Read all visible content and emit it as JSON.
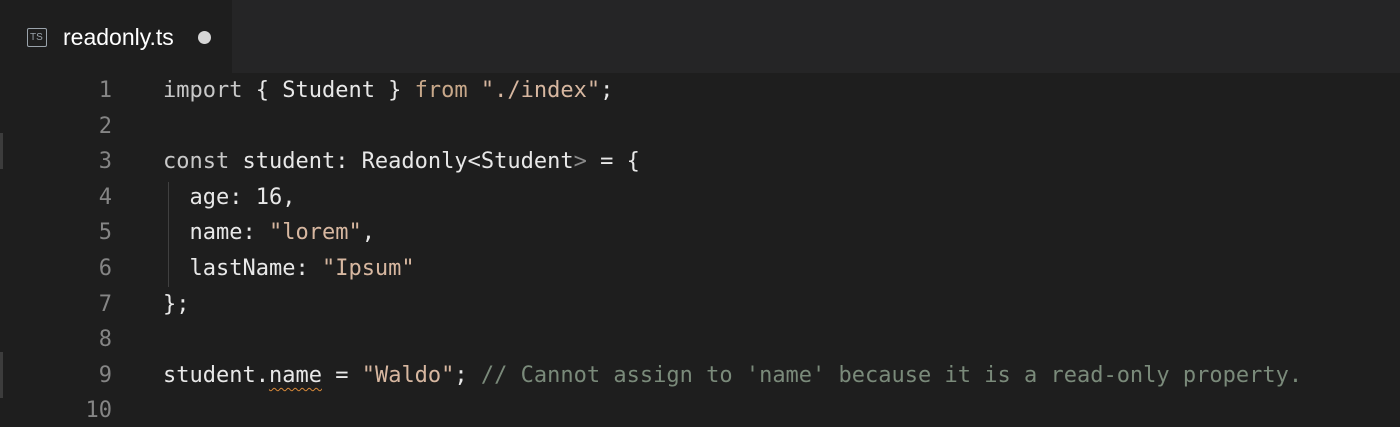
{
  "tab": {
    "icon": "ts-file-icon",
    "icon_text": "TS",
    "filename": "readonly.ts",
    "dirty": true
  },
  "editor": {
    "line_numbers": [
      "1",
      "2",
      "3",
      "4",
      "5",
      "6",
      "7",
      "8",
      "9",
      "10"
    ],
    "lines": [
      {
        "tokens": [
          {
            "t": "import",
            "c": "c-import"
          },
          {
            "t": " { Student } ",
            "c": "c-ident"
          },
          {
            "t": "from",
            "c": "c-from"
          },
          {
            "t": " ",
            "c": "c-ident"
          },
          {
            "t": "\"./index\"",
            "c": "c-str"
          },
          {
            "t": ";",
            "c": "c-ident"
          }
        ]
      },
      {
        "tokens": []
      },
      {
        "tokens": [
          {
            "t": "const",
            "c": "c-const"
          },
          {
            "t": " student: Readonly<Student",
            "c": "c-ident"
          },
          {
            "t": ">",
            "c": "c-gt"
          },
          {
            "t": " = {",
            "c": "c-ident"
          }
        ]
      },
      {
        "tokens": [
          {
            "t": "  age: 16,",
            "c": "c-ident"
          }
        ]
      },
      {
        "tokens": [
          {
            "t": "  name: ",
            "c": "c-ident"
          },
          {
            "t": "\"lorem\"",
            "c": "c-str"
          },
          {
            "t": ",",
            "c": "c-ident"
          }
        ]
      },
      {
        "tokens": [
          {
            "t": "  lastName: ",
            "c": "c-ident"
          },
          {
            "t": "\"Ipsum\"",
            "c": "c-str"
          }
        ]
      },
      {
        "tokens": [
          {
            "t": "};",
            "c": "c-ident"
          }
        ]
      },
      {
        "tokens": []
      },
      {
        "tokens": [
          {
            "t": "student.",
            "c": "c-ident"
          },
          {
            "t": "name",
            "c": "c-ident squiggle"
          },
          {
            "t": " = ",
            "c": "c-ident"
          },
          {
            "t": "\"Waldo\"",
            "c": "c-str"
          },
          {
            "t": "; ",
            "c": "c-ident"
          },
          {
            "t": "// Cannot assign to 'name' because it is a read-only property.",
            "c": "c-cmt"
          }
        ]
      },
      {
        "tokens": []
      }
    ]
  }
}
